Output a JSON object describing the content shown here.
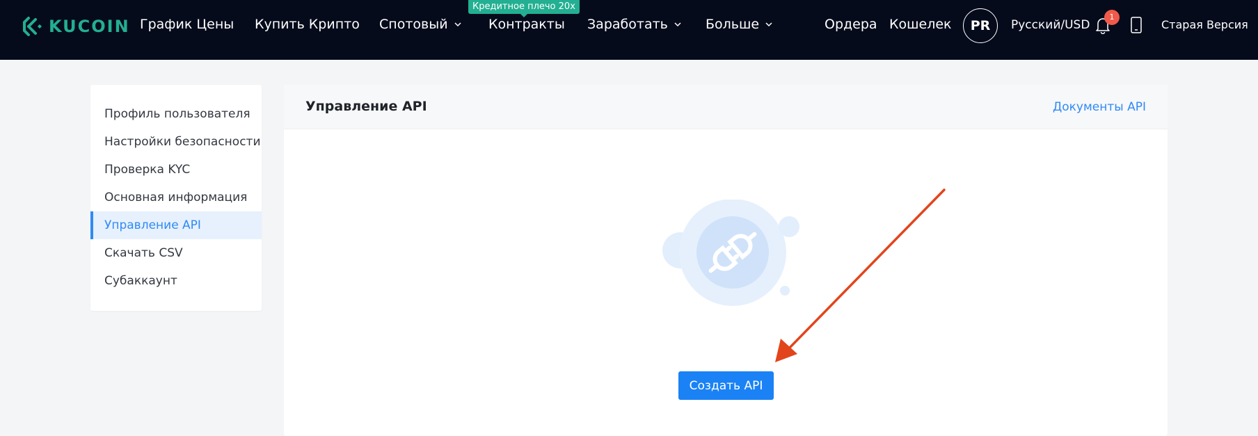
{
  "header": {
    "logo_text": "KUCOIN",
    "brand_color": "#23af91",
    "nav": [
      {
        "label": "График Цены",
        "dropdown": false
      },
      {
        "label": "Купить Крипто",
        "dropdown": false
      },
      {
        "label": "Спотовый",
        "dropdown": true
      },
      {
        "label": "Контракты",
        "dropdown": false
      },
      {
        "label": "Заработать",
        "dropdown": true
      },
      {
        "label": "Больше",
        "dropdown": true
      }
    ],
    "promo_badge": "Кредитное плечо 20x",
    "orders": "Ордера",
    "wallet": "Кошелек",
    "avatar_initials": "PR",
    "language_currency": "Русский/USD",
    "notification_count": "1",
    "old_version": "Старая Версия"
  },
  "sidebar": {
    "items": [
      {
        "label": "Профиль пользователя",
        "active": false
      },
      {
        "label": "Настройки безопасности",
        "active": false
      },
      {
        "label": "Проверка KYC",
        "active": false
      },
      {
        "label": "Основная информация",
        "active": false
      },
      {
        "label": "Управление API",
        "active": true
      },
      {
        "label": "Скачать CSV",
        "active": false
      },
      {
        "label": "Субаккаунт",
        "active": false
      }
    ]
  },
  "main": {
    "title": "Управление API",
    "docs_link": "Документы API",
    "create_button": "Создать API",
    "empty_icon": "plug-icon",
    "accent_color": "#1a82f5"
  },
  "annotation": {
    "arrow_color": "#e2451c",
    "points_to": "create-api-button"
  }
}
